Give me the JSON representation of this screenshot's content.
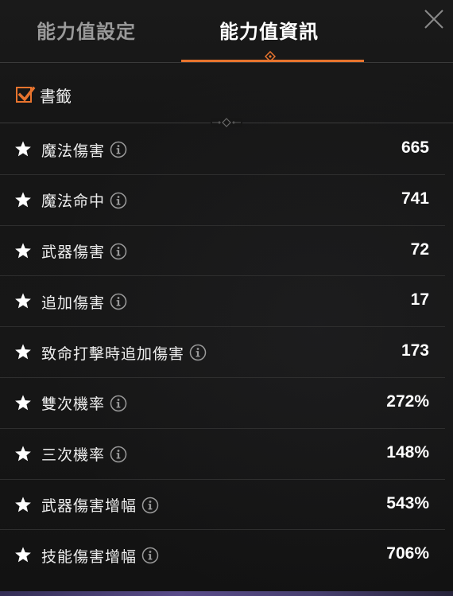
{
  "tabs": [
    {
      "label": "能力值設定",
      "active": false
    },
    {
      "label": "能力值資訊",
      "active": true
    }
  ],
  "accent_color": "#e8742e",
  "bookmark": {
    "label": "書籤",
    "checked": true
  },
  "stats": [
    {
      "label": "魔法傷害",
      "value": "665"
    },
    {
      "label": "魔法命中",
      "value": "741"
    },
    {
      "label": "武器傷害",
      "value": "72"
    },
    {
      "label": "追加傷害",
      "value": "17"
    },
    {
      "label": "致命打擊時追加傷害",
      "value": "173"
    },
    {
      "label": "雙次機率",
      "value": "272%"
    },
    {
      "label": "三次機率",
      "value": "148%"
    },
    {
      "label": "武器傷害增幅",
      "value": "543%"
    },
    {
      "label": "技能傷害增幅",
      "value": "706%"
    }
  ],
  "icons": {
    "close": "close-icon",
    "star": "star-icon",
    "info": "info-icon",
    "check": "checkmark-icon"
  }
}
